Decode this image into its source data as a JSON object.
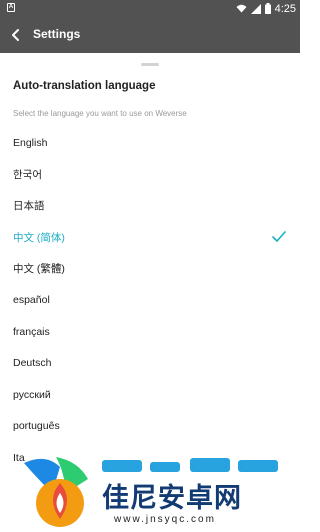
{
  "status_bar": {
    "time": "4:25"
  },
  "app_bar": {
    "title": "Settings"
  },
  "sheet": {
    "title": "Auto-translation language",
    "subtitle": "Select the language you want to use on Weverse",
    "selected_index": 3,
    "languages": [
      {
        "label": "English"
      },
      {
        "label": "한국어"
      },
      {
        "label": "日本語"
      },
      {
        "label": "中文 (简体)"
      },
      {
        "label": "中文 (繁體)"
      },
      {
        "label": "español"
      },
      {
        "label": "français"
      },
      {
        "label": "Deutsch"
      },
      {
        "label": "русский"
      },
      {
        "label": "português"
      },
      {
        "label": "Ita"
      }
    ]
  },
  "colors": {
    "accent": "#1aaec4",
    "bar": "#525252"
  },
  "watermark": {
    "text": "佳尼安卓网",
    "url": "www.jnsyqc.com"
  }
}
